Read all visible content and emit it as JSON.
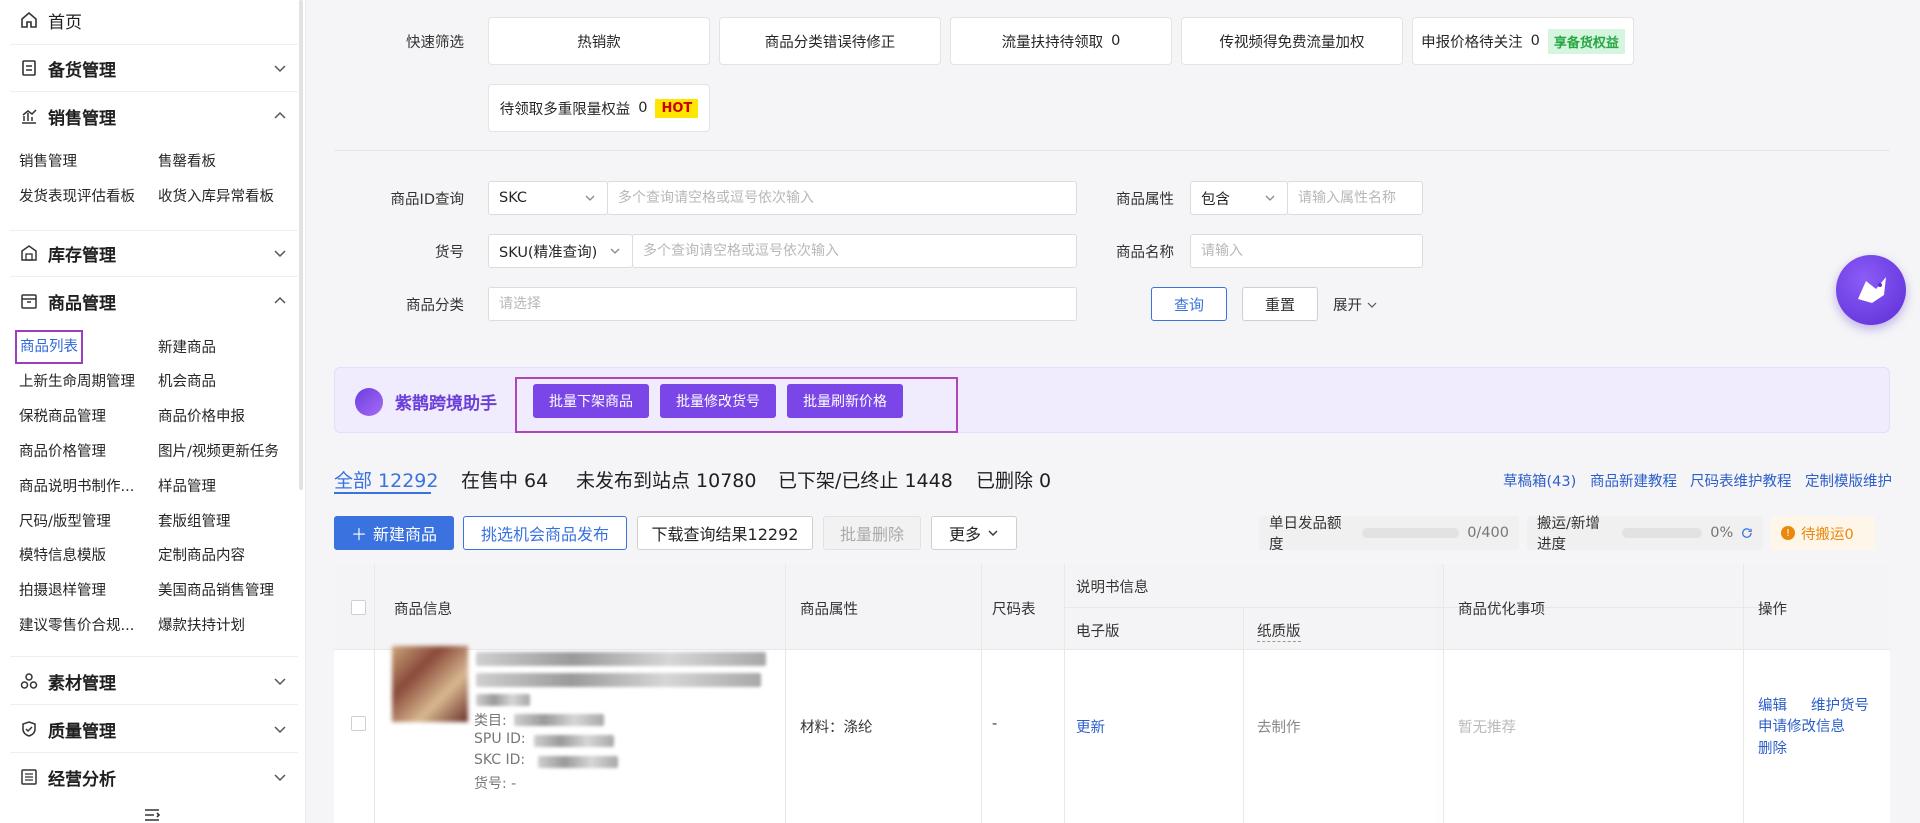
{
  "sidebar": {
    "home": "首页",
    "groups": [
      "备货管理",
      "销售管理",
      "库存管理",
      "商品管理",
      "素材管理",
      "质量管理",
      "经营分析"
    ],
    "sales_items": [
      "销售管理",
      "售罄看板",
      "发货表现评估看板",
      "收货入库异常看板"
    ],
    "product_items": [
      "商品列表",
      "新建商品",
      "上新生命周期管理",
      "机会商品",
      "保税商品管理",
      "商品价格申报",
      "商品价格管理",
      "图片/视频更新任务",
      "商品说明书制作...",
      "样品管理",
      "尺码/版型管理",
      "套版组管理",
      "模特信息模版",
      "定制商品内容",
      "拍摄退样管理",
      "美国商品销售管理",
      "建议零售价合规...",
      "爆款扶持计划"
    ]
  },
  "filters": {
    "quick_label": "快速筛选",
    "quick": [
      {
        "label": "热销款"
      },
      {
        "label": "商品分类错误待修正"
      },
      {
        "label": "流量扶持待领取",
        "count": "0"
      },
      {
        "label": "传视频得免费流量加权"
      },
      {
        "label": "申报价格待关注",
        "count": "0",
        "badge": "享备货权益"
      },
      {
        "label": "待领取多重限量权益",
        "count": "0",
        "badge": "HOT"
      }
    ],
    "id_label": "商品ID查询",
    "id_select": "SKC",
    "id_placeholder": "多个查询请空格或逗号依次输入",
    "sku_label": "货号",
    "sku_select": "SKU(精准查询)",
    "sku_placeholder": "多个查询请空格或逗号依次输入",
    "cat_label": "商品分类",
    "cat_placeholder": "请选择",
    "attr_label": "商品属性",
    "attr_select": "包含",
    "attr_placeholder": "请输入属性名称",
    "name_label": "商品名称",
    "name_placeholder": "请输入",
    "search": "查询",
    "reset": "重置",
    "expand": "展开"
  },
  "assistant": {
    "name": "紫鹊跨境助手",
    "buttons": [
      "批量下架商品",
      "批量修改货号",
      "批量刷新价格"
    ]
  },
  "tabs": [
    "全部 12292",
    "在售中 64",
    "未发布到站点 10780",
    "已下架/已终止 1448",
    "已删除 0"
  ],
  "links": [
    "草稿箱(43)",
    "商品新建教程",
    "尺码表维护教程",
    "定制模版维护"
  ],
  "actions": {
    "new": "新建商品",
    "opp": "挑选机会商品发布",
    "download": "下载查询结果12292",
    "batch_delete": "批量删除",
    "more": "更多"
  },
  "meters": {
    "daily_label": "单日发品额度",
    "daily_value": "0/400",
    "daily_pct": 0,
    "move_label": "搬运/新增进度",
    "move_value": "0%",
    "move_pct": 0,
    "pending": "待搬运0"
  },
  "table": {
    "headers": {
      "info": "商品信息",
      "attr": "商品属性",
      "size": "尺码表",
      "manual": "说明书信息",
      "electronic": "电子版",
      "paper": "纸质版",
      "optimize": "商品优化事项",
      "ops": "操作"
    },
    "row": {
      "category": "类目:",
      "spu": "SPU ID:",
      "skc": "SKC ID:",
      "huohao": "货号: -",
      "attr": "材料：涤纶",
      "size": "-",
      "electronic": "更新",
      "paper": "去制作",
      "optimize": "暂无推荐",
      "op_edit": "编辑",
      "op_sku": "维护货号",
      "op_apply": "申请修改信息",
      "op_delete": "删除"
    }
  },
  "colors": {
    "primary": "#3a72e0",
    "purple": "#7a46e8",
    "highlight_border": "#b045b8"
  }
}
